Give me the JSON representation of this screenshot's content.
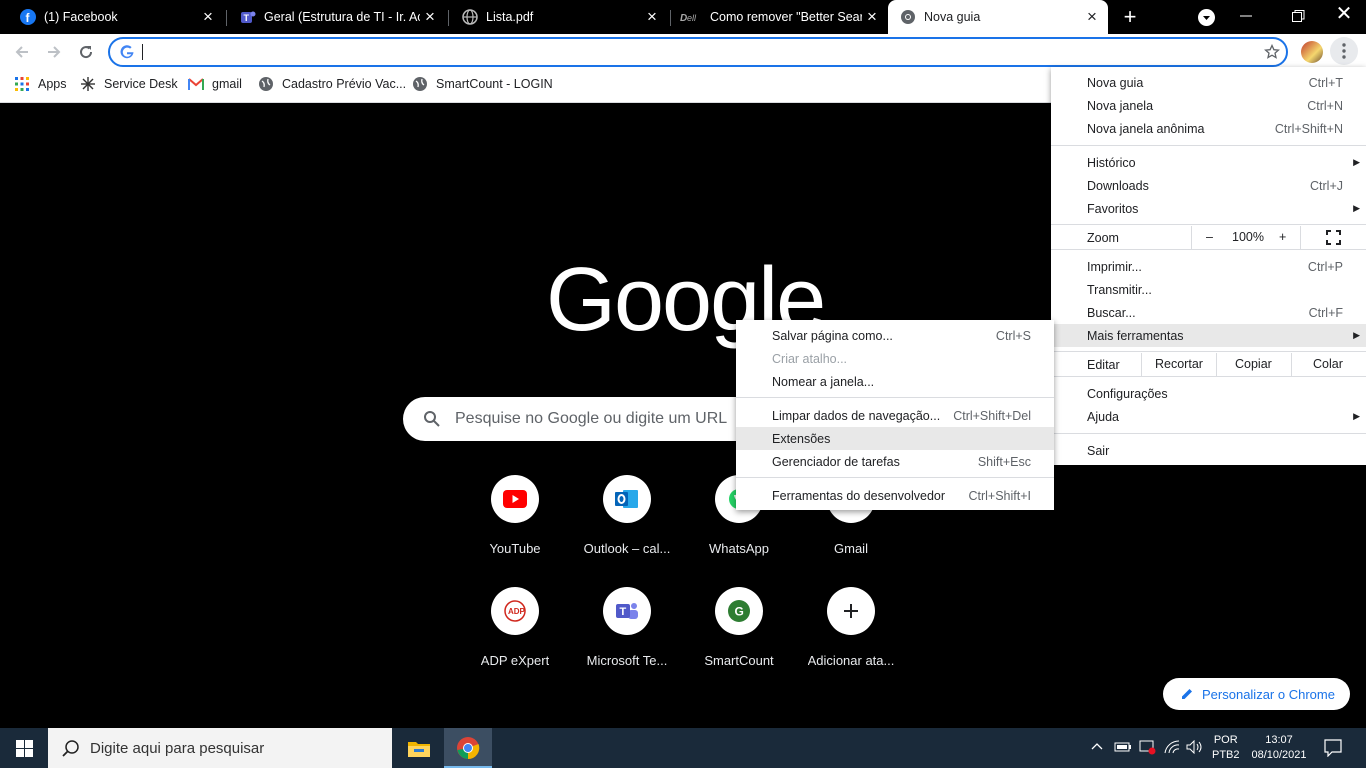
{
  "tabs": [
    {
      "title": "(1) Facebook",
      "icon": "facebook-icon"
    },
    {
      "title": "Geral (Estrutura de TI - Ir. Acácio",
      "icon": "teams-icon"
    },
    {
      "title": "Lista.pdf",
      "icon": "globe-icon"
    },
    {
      "title": "Como remover \"Better Search",
      "icon": "dell-icon"
    },
    {
      "title": "Nova guia",
      "icon": "chrome-icon"
    }
  ],
  "bookmarks": [
    {
      "label": "Apps",
      "icon": "apps-grid-icon"
    },
    {
      "label": "Service Desk",
      "icon": "service-desk-icon"
    },
    {
      "label": "gmail",
      "icon": "gmail-icon"
    },
    {
      "label": "Cadastro Prévio Vac...",
      "icon": "globe-icon"
    },
    {
      "label": "SmartCount - LOGIN",
      "icon": "globe-icon"
    }
  ],
  "newtab": {
    "logo": "Google",
    "search_placeholder": "Pesquise no Google ou digite um URL",
    "shortcuts": [
      {
        "label": "YouTube",
        "icon": "youtube-icon"
      },
      {
        "label": "Outlook – cal...",
        "icon": "outlook-icon"
      },
      {
        "label": "WhatsApp",
        "icon": "whatsapp-icon"
      },
      {
        "label": "Gmail",
        "icon": "gmail-icon"
      },
      {
        "label": "ADP eXpert",
        "icon": "adp-icon"
      },
      {
        "label": "Microsoft Te...",
        "icon": "teams-icon"
      },
      {
        "label": "SmartCount",
        "icon": "smartcount-icon"
      },
      {
        "label": "Adicionar ata...",
        "icon": "add-icon"
      }
    ],
    "customize_label": "Personalizar o Chrome"
  },
  "main_menu": {
    "new_tab": {
      "label": "Nova guia",
      "shortcut": "Ctrl+T"
    },
    "new_window": {
      "label": "Nova janela",
      "shortcut": "Ctrl+N"
    },
    "incognito": {
      "label": "Nova janela anônima",
      "shortcut": "Ctrl+Shift+N"
    },
    "history": {
      "label": "Histórico"
    },
    "downloads": {
      "label": "Downloads",
      "shortcut": "Ctrl+J"
    },
    "bookmarks": {
      "label": "Favoritos"
    },
    "zoom": {
      "label": "Zoom",
      "minus": "–",
      "value": "100%",
      "plus": "+"
    },
    "print": {
      "label": "Imprimir...",
      "shortcut": "Ctrl+P"
    },
    "cast": {
      "label": "Transmitir..."
    },
    "find": {
      "label": "Buscar...",
      "shortcut": "Ctrl+F"
    },
    "more_tools": {
      "label": "Mais ferramentas"
    },
    "edit": {
      "label": "Editar",
      "cut": "Recortar",
      "copy": "Copiar",
      "paste": "Colar"
    },
    "settings": {
      "label": "Configurações"
    },
    "help": {
      "label": "Ajuda"
    },
    "exit": {
      "label": "Sair"
    }
  },
  "submenu": {
    "save_page": {
      "label": "Salvar página como...",
      "shortcut": "Ctrl+S"
    },
    "create_shortcut": {
      "label": "Criar atalho..."
    },
    "name_window": {
      "label": "Nomear a janela..."
    },
    "clear_data": {
      "label": "Limpar dados de navegação...",
      "shortcut": "Ctrl+Shift+Del"
    },
    "extensions": {
      "label": "Extensões"
    },
    "task_manager": {
      "label": "Gerenciador de tarefas",
      "shortcut": "Shift+Esc"
    },
    "devtools": {
      "label": "Ferramentas do desenvolvedor",
      "shortcut": "Ctrl+Shift+I"
    }
  },
  "taskbar": {
    "search_placeholder": "Digite aqui para pesquisar",
    "lang_top": "POR",
    "lang_bottom": "PTB2",
    "time": "13:07",
    "date": "08/10/2021"
  },
  "colors": {
    "accent": "#1a73e8",
    "taskbar": "#1a2a3a"
  }
}
